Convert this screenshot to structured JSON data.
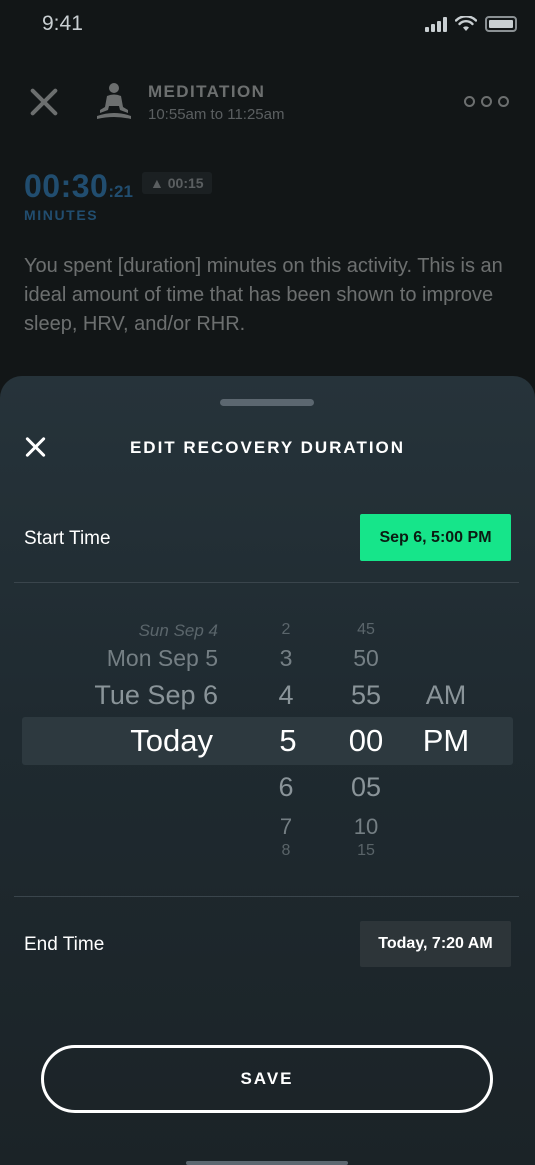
{
  "status_bar": {
    "time": "9:41"
  },
  "activity": {
    "title": "MEDITATION",
    "time_range": "10:55am to 11:25am",
    "duration_main": "00:30",
    "duration_seconds": ":21",
    "delta": "▲ 00:15",
    "duration_unit": "MINUTES",
    "description": "You spent [duration] minutes on this activity. This is an ideal amount of time that has been shown to improve sleep, HRV, and/or RHR."
  },
  "sheet": {
    "title": "EDIT RECOVERY DURATION",
    "start_label": "Start Time",
    "start_value": "Sep 6, 5:00 PM",
    "end_label": "End Time",
    "end_value": "Today, 7:20 AM",
    "save_label": "SAVE"
  },
  "picker": {
    "dates": [
      "Sun Sep 4",
      "Mon Sep 5",
      "Tue Sep 6",
      "Today"
    ],
    "hours": [
      "2",
      "3",
      "4",
      "5",
      "6",
      "7",
      "8"
    ],
    "minutes": [
      "45",
      "50",
      "55",
      "00",
      "05",
      "10",
      "15"
    ],
    "ampm": [
      "AM",
      "PM"
    ],
    "selected": {
      "date": "Today",
      "hour": "5",
      "minute": "00",
      "ampm": "PM"
    }
  },
  "colors": {
    "accent_green": "#16e58a",
    "accent_blue": "#3aa8ff",
    "sheet_bg": "#26333a"
  }
}
